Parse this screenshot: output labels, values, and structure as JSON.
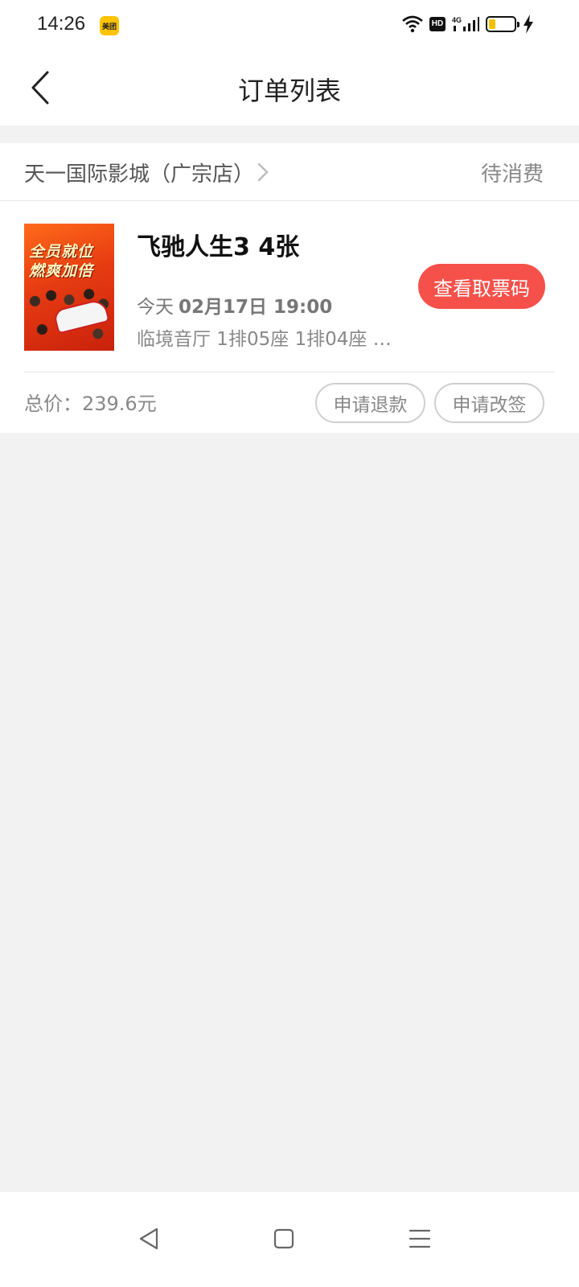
{
  "status_bar": {
    "time": "14:26",
    "app_badge": "美团",
    "network": "4G",
    "hd_label": "HD"
  },
  "header": {
    "title": "订单列表"
  },
  "order": {
    "cinema_name": "天一国际影城（广宗店）",
    "status": "待消费",
    "poster": {
      "line1": "全员就位",
      "line2": "燃爽加倍"
    },
    "movie_title": "飞驰人生3 4张",
    "show_day": "今天",
    "show_datetime": "02月17日 19:00",
    "seat_info": "临境音厅 1排05座 1排04座 1…",
    "ticket_code_button": "查看取票码",
    "total_price": "总价：239.6元",
    "refund_button": "申请退款",
    "change_button": "申请改签"
  },
  "colors": {
    "accent": "#f6504a",
    "background": "#f2f2f2",
    "card": "#ffffff"
  }
}
